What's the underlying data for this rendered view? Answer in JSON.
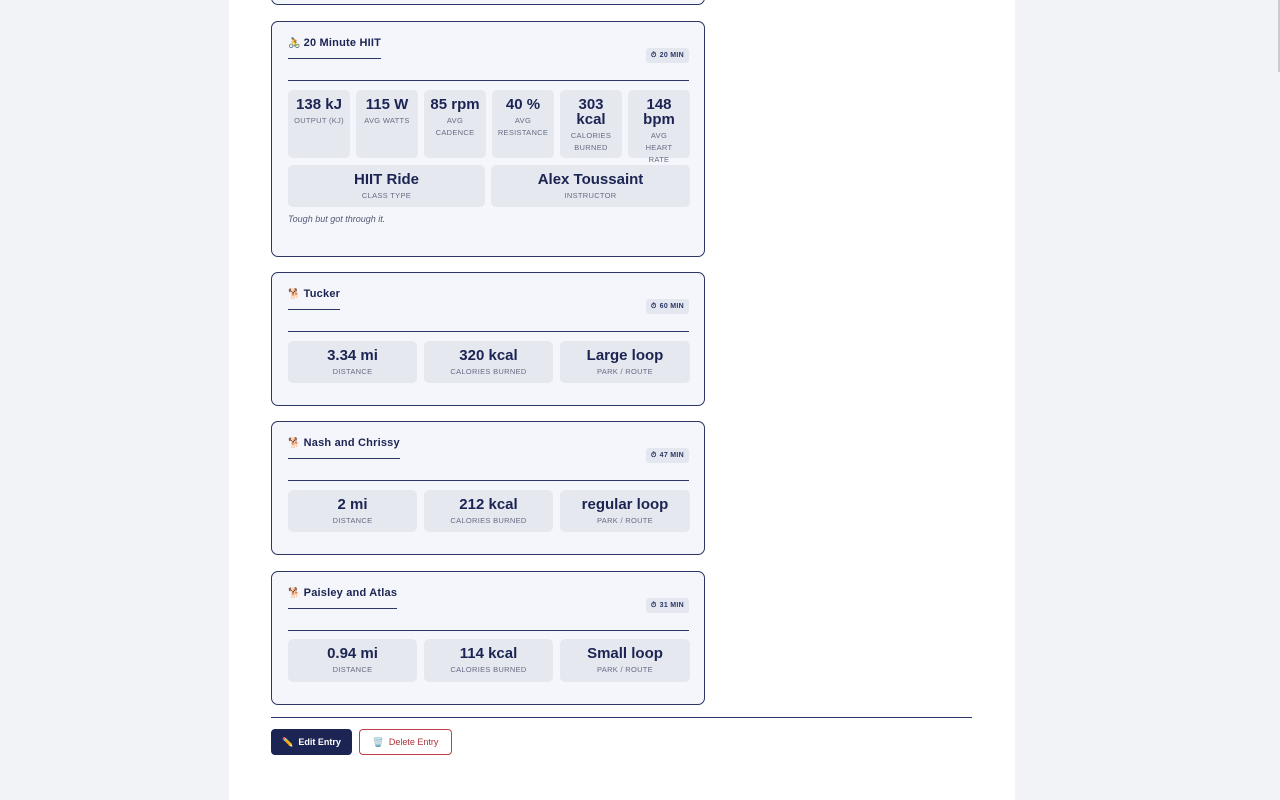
{
  "workouts": [
    {
      "emoji": "🚴",
      "title": "20 Minute HIIT",
      "duration": "20 MIN",
      "stats": [
        {
          "value": "138 kJ",
          "label": "OUTPUT (KJ)"
        },
        {
          "value": "115 W",
          "label": "AVG WATTS"
        },
        {
          "value": "85 rpm",
          "label": "AVG CADENCE"
        },
        {
          "value": "40 %",
          "label": "AVG RESISTANCE"
        },
        {
          "value": "303 kcal",
          "label": "CALORIES BURNED"
        },
        {
          "value": "148 bpm",
          "label": "AVG HEART RATE"
        }
      ],
      "wide_stats": [
        {
          "value": "HIIT Ride",
          "label": "CLASS TYPE"
        },
        {
          "value": "Alex Toussaint",
          "label": "INSTRUCTOR"
        }
      ],
      "note": "Tough but got through it."
    },
    {
      "emoji": "🐕",
      "title": "Tucker",
      "duration": "60 MIN",
      "stats": [
        {
          "value": "3.34 mi",
          "label": "DISTANCE"
        },
        {
          "value": "320 kcal",
          "label": "CALORIES BURNED"
        },
        {
          "value": "Large loop",
          "label": "PARK / ROUTE"
        }
      ]
    },
    {
      "emoji": "🐕",
      "title": "Nash and Chrissy",
      "duration": "47 MIN",
      "stats": [
        {
          "value": "2 mi",
          "label": "DISTANCE"
        },
        {
          "value": "212 kcal",
          "label": "CALORIES BURNED"
        },
        {
          "value": "regular loop",
          "label": "PARK / ROUTE"
        }
      ]
    },
    {
      "emoji": "🐕",
      "title": "Paisley and Atlas",
      "duration": "31 MIN",
      "stats": [
        {
          "value": "0.94 mi",
          "label": "DISTANCE"
        },
        {
          "value": "114 kcal",
          "label": "CALORIES BURNED"
        },
        {
          "value": "Small loop",
          "label": "PARK / ROUTE"
        }
      ]
    }
  ],
  "icons": {
    "duration": "⏱",
    "edit": "✏️",
    "delete": "🗑️"
  },
  "actions": {
    "edit_label": "Edit Entry",
    "delete_label": "Delete Entry"
  },
  "colors": {
    "accent": "#1b2452",
    "card_bg": "#f4f6fb",
    "stat_bg": "#e6e8ef",
    "danger": "#b0303a"
  }
}
